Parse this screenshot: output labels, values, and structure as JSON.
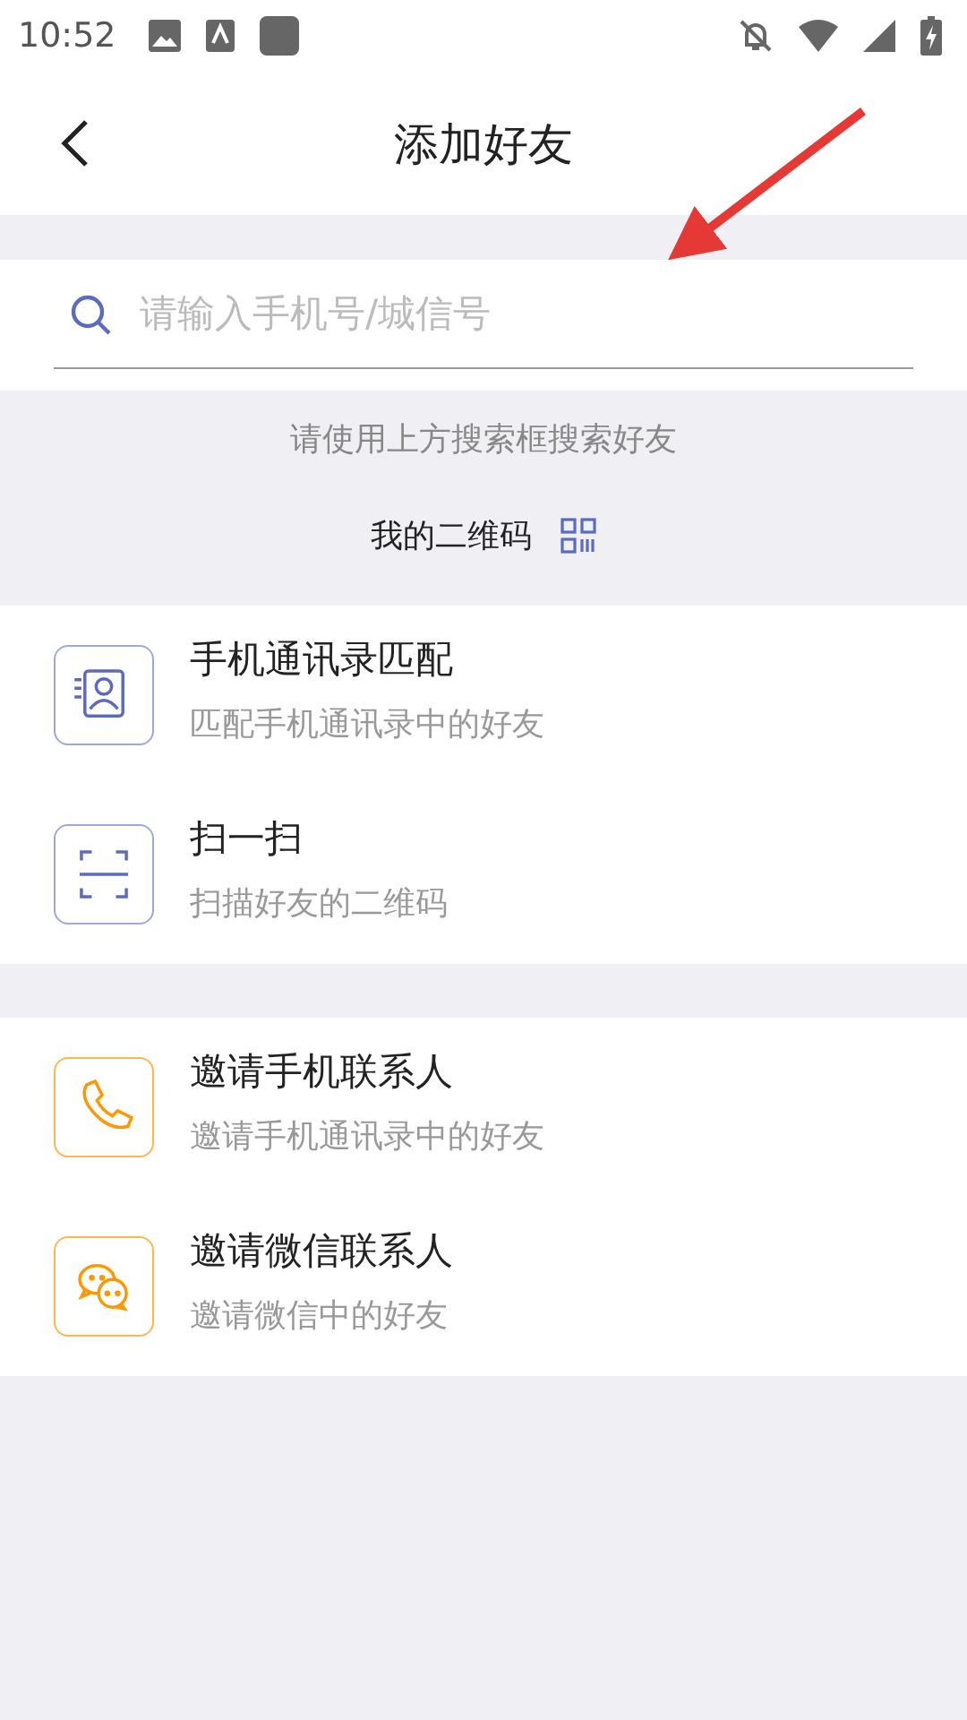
{
  "status_bar": {
    "time": "10:52"
  },
  "header": {
    "title": "添加好友"
  },
  "search": {
    "placeholder": "请输入手机号/城信号"
  },
  "hint": "请使用上方搜索框搜索好友",
  "my_qr": {
    "label": "我的二维码"
  },
  "sections": [
    {
      "items": [
        {
          "kind": "contacts",
          "title": "手机通讯录匹配",
          "subtitle": "匹配手机通讯录中的好友"
        },
        {
          "kind": "scan",
          "title": "扫一扫",
          "subtitle": "扫描好友的二维码"
        }
      ]
    },
    {
      "items": [
        {
          "kind": "phone",
          "title": "邀请手机联系人",
          "subtitle": "邀请手机通讯录中的好友"
        },
        {
          "kind": "wechat",
          "title": "邀请微信联系人",
          "subtitle": "邀请微信中的好友"
        }
      ]
    }
  ]
}
